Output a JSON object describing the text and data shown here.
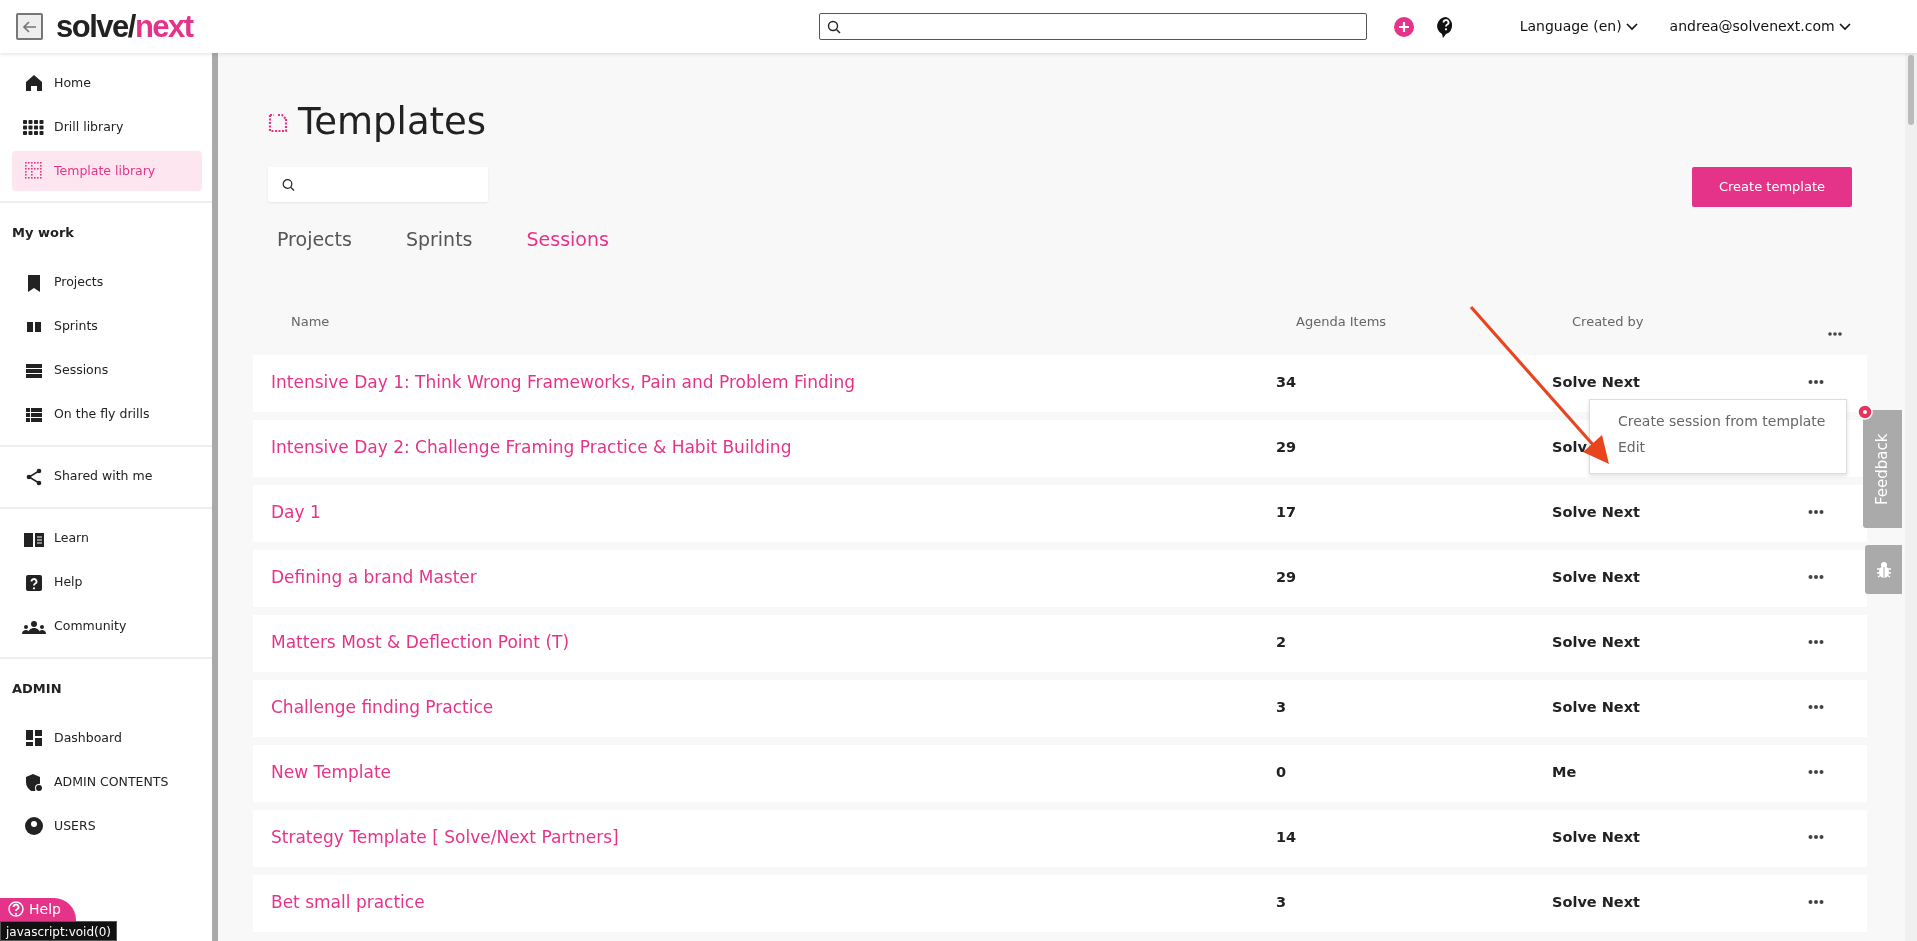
{
  "header": {
    "logo": {
      "dark": "solve/",
      "accent": "next"
    },
    "language": "Language (en)",
    "user": "andrea@solvenext.com"
  },
  "sidebar": {
    "sections": [
      {
        "items": [
          {
            "label": "Home",
            "selected": false
          },
          {
            "label": "Drill library",
            "selected": false
          },
          {
            "label": "Template library",
            "selected": true
          }
        ]
      },
      {
        "title": "My work",
        "items": [
          {
            "label": "Projects",
            "selected": false
          },
          {
            "label": "Sprints",
            "selected": false
          },
          {
            "label": "Sessions",
            "selected": false
          },
          {
            "label": "On the fly drills",
            "selected": false
          }
        ]
      },
      {
        "items": [
          {
            "label": "Shared with me",
            "selected": false
          }
        ]
      },
      {
        "items": [
          {
            "label": "Learn",
            "selected": false
          },
          {
            "label": "Help",
            "selected": false
          },
          {
            "label": "Community",
            "selected": false
          }
        ]
      },
      {
        "title": "ADMIN",
        "items": [
          {
            "label": "Dashboard",
            "selected": false
          },
          {
            "label": "ADMIN CONTENTS",
            "selected": false
          },
          {
            "label": "USERS",
            "selected": false
          }
        ]
      }
    ]
  },
  "page": {
    "title": "Templates",
    "create_button": "Create template",
    "tabs": [
      {
        "label": "Projects",
        "selected": false
      },
      {
        "label": "Sprints",
        "selected": false
      },
      {
        "label": "Sessions",
        "selected": true
      }
    ],
    "table": {
      "columns": [
        "Name",
        "Agenda Items",
        "Created by"
      ],
      "rows": [
        {
          "name": "Intensive Day 1: Think Wrong Frameworks, Pain and Problem Finding",
          "agenda_items": "34",
          "created_by": "Solve Next",
          "menu_open": true
        },
        {
          "name": "Intensive Day 2: Challenge Framing Practice & Habit Building",
          "agenda_items": "29",
          "created_by": "Solv",
          "menu_open": false
        },
        {
          "name": "Day 1",
          "agenda_items": "17",
          "created_by": "Solve Next",
          "menu_open": false
        },
        {
          "name": "Defining a brand Master",
          "agenda_items": "29",
          "created_by": "Solve Next",
          "menu_open": false
        },
        {
          "name": "Matters Most & Deflection Point (T)",
          "agenda_items": "2",
          "created_by": "Solve Next",
          "menu_open": false
        },
        {
          "name": "Challenge finding Practice",
          "agenda_items": "3",
          "created_by": "Solve Next",
          "menu_open": false
        },
        {
          "name": "New Template",
          "agenda_items": "0",
          "created_by": "Me",
          "menu_open": false
        },
        {
          "name": "Strategy Template [ Solve/Next Partners]",
          "agenda_items": "14",
          "created_by": "Solve Next",
          "menu_open": false
        },
        {
          "name": "Bet small practice",
          "agenda_items": "3",
          "created_by": "Solve Next",
          "menu_open": false
        }
      ]
    },
    "row_menu": [
      "Create session from template",
      "Edit"
    ]
  },
  "feedback": "Feedback",
  "help_button": "Help",
  "status_link": "javascript:void(0)"
}
